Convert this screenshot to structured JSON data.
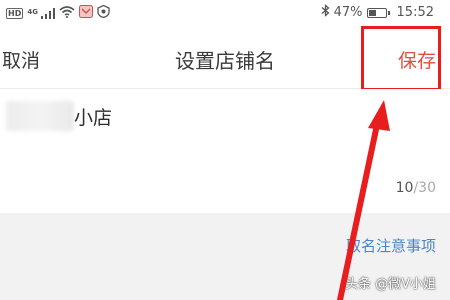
{
  "status_bar": {
    "left_hd": "HD",
    "left_network": "4G",
    "battery_percent_text": "47%",
    "battery_level": 0.47,
    "time": "15:52",
    "icons": [
      "hd-icon",
      "4g-signal-icon",
      "wifi-icon",
      "notification-app-icon",
      "shield-app-icon",
      "bluetooth-icon",
      "battery-icon"
    ]
  },
  "header": {
    "cancel_label": "取消",
    "title": "设置店铺名",
    "save_label": "保存"
  },
  "name_field": {
    "visible_suffix": "小店",
    "char_count_current": "10",
    "char_count_separator": "/",
    "char_count_max": "30"
  },
  "lower": {
    "naming_rules_link": "取名注意事项"
  },
  "watermark": {
    "text": "头条 @微V小姐"
  },
  "colors": {
    "accent_save": "#e0503c",
    "annotation_red": "#e81e1e",
    "link_blue": "#4a86c8",
    "lower_bg": "#f2f2f2"
  }
}
